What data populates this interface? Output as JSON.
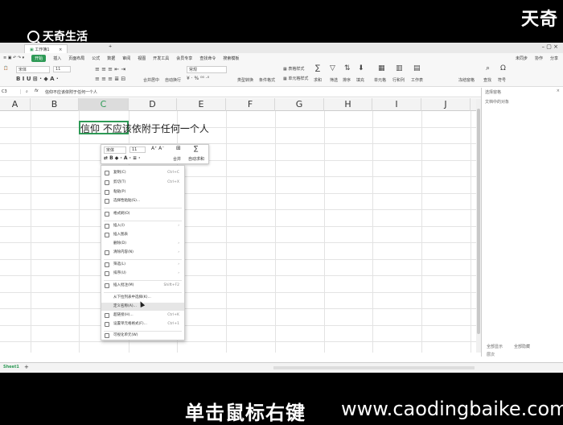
{
  "watermark": {
    "brand": "天奇生活",
    "corner": "天奇"
  },
  "window": {
    "tab_title": "工作簿1",
    "menu": [
      "开始",
      "插入",
      "页面布局",
      "公式",
      "数据",
      "审阅",
      "视图",
      "开发工具",
      "会员专享",
      "查找命令",
      "搜索模板"
    ],
    "right_menu": [
      "未同步",
      "协作",
      "分享"
    ]
  },
  "ribbon": {
    "font": "宋体",
    "size": "11",
    "number_format": "常规",
    "sum_label": "求和",
    "filter_label": "筛选",
    "sort_label": "排序",
    "fill_label": "填充",
    "cell_label": "单元格",
    "rowcol_label": "行和列",
    "sheet_label": "工作表",
    "find_label": "查找",
    "symbol_label": "符号"
  },
  "formula_bar": {
    "text": "信仰不应该依附于任何一个人"
  },
  "columns": [
    "A",
    "B",
    "C",
    "D",
    "E",
    "F",
    "G",
    "H",
    "I",
    "J"
  ],
  "selected_column": "C",
  "cell": {
    "display_text": "信仰 不应该依附于任何一个人"
  },
  "mini_toolbar": {
    "font": "宋体",
    "size": "11",
    "merge_label": "合并",
    "autosum_label": "自动求和"
  },
  "context_menu": [
    {
      "label": "复制(C)",
      "shortcut": "Ctrl+C"
    },
    {
      "label": "剪切(T)",
      "shortcut": "Ctrl+X"
    },
    {
      "label": "粘贴(P)",
      "shortcut": ""
    },
    {
      "label": "选择性粘贴(S)...",
      "shortcut": ""
    },
    {
      "label": "格式刷(O)",
      "shortcut": ""
    },
    {
      "label": "插入(I)",
      "shortcut": "›"
    },
    {
      "label": "插入图表",
      "shortcut": ""
    },
    {
      "label": "删除(D)",
      "shortcut": "›"
    },
    {
      "label": "清除内容(N)",
      "shortcut": "›"
    },
    {
      "label": "筛选(L)",
      "shortcut": "›"
    },
    {
      "label": "排序(U)",
      "shortcut": "›"
    },
    {
      "label": "插入批注(M)",
      "shortcut": "Shift+F2"
    },
    {
      "label": "从下拉列表中选择(K)...",
      "shortcut": ""
    },
    {
      "label": "定义名称(A)...",
      "shortcut": ""
    },
    {
      "label": "超链接(H)...",
      "shortcut": "Ctrl+K"
    },
    {
      "label": "设置单元格格式(F)...",
      "shortcut": "Ctrl+1"
    },
    {
      "label": "可视化单元(W)",
      "shortcut": ""
    }
  ],
  "side_panel": {
    "title": "选择窗格",
    "subtitle": "文档中的对象",
    "show_all": "全部显示",
    "hide_all": "全部隐藏",
    "layer": "层次"
  },
  "sheet": {
    "name": "Sheet1",
    "add": "+"
  },
  "caption": {
    "text": "单击鼠标右键",
    "website": "www.caodingbaike.com"
  },
  "colors": {
    "accent": "#2e9a56",
    "background": "#ffffff",
    "frame": "#000000"
  }
}
